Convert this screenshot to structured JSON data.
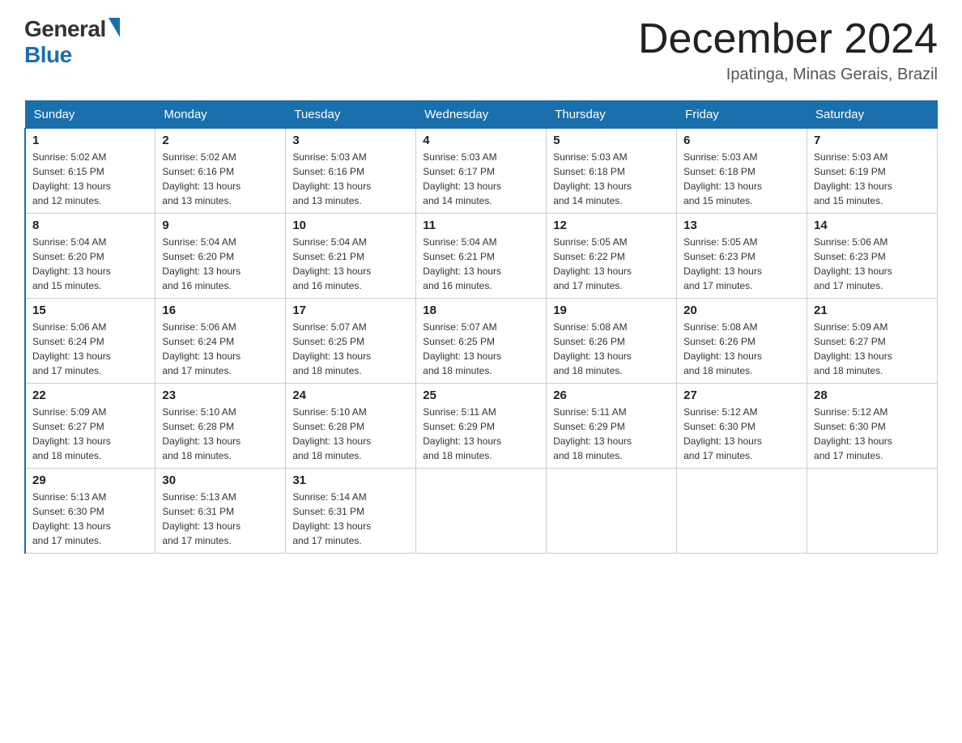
{
  "logo": {
    "general": "General",
    "blue": "Blue"
  },
  "header": {
    "month_year": "December 2024",
    "location": "Ipatinga, Minas Gerais, Brazil"
  },
  "weekdays": [
    "Sunday",
    "Monday",
    "Tuesday",
    "Wednesday",
    "Thursday",
    "Friday",
    "Saturday"
  ],
  "weeks": [
    [
      {
        "day": "1",
        "sunrise": "5:02 AM",
        "sunset": "6:15 PM",
        "daylight": "13 hours and 12 minutes."
      },
      {
        "day": "2",
        "sunrise": "5:02 AM",
        "sunset": "6:16 PM",
        "daylight": "13 hours and 13 minutes."
      },
      {
        "day": "3",
        "sunrise": "5:03 AM",
        "sunset": "6:16 PM",
        "daylight": "13 hours and 13 minutes."
      },
      {
        "day": "4",
        "sunrise": "5:03 AM",
        "sunset": "6:17 PM",
        "daylight": "13 hours and 14 minutes."
      },
      {
        "day": "5",
        "sunrise": "5:03 AM",
        "sunset": "6:18 PM",
        "daylight": "13 hours and 14 minutes."
      },
      {
        "day": "6",
        "sunrise": "5:03 AM",
        "sunset": "6:18 PM",
        "daylight": "13 hours and 15 minutes."
      },
      {
        "day": "7",
        "sunrise": "5:03 AM",
        "sunset": "6:19 PM",
        "daylight": "13 hours and 15 minutes."
      }
    ],
    [
      {
        "day": "8",
        "sunrise": "5:04 AM",
        "sunset": "6:20 PM",
        "daylight": "13 hours and 15 minutes."
      },
      {
        "day": "9",
        "sunrise": "5:04 AM",
        "sunset": "6:20 PM",
        "daylight": "13 hours and 16 minutes."
      },
      {
        "day": "10",
        "sunrise": "5:04 AM",
        "sunset": "6:21 PM",
        "daylight": "13 hours and 16 minutes."
      },
      {
        "day": "11",
        "sunrise": "5:04 AM",
        "sunset": "6:21 PM",
        "daylight": "13 hours and 16 minutes."
      },
      {
        "day": "12",
        "sunrise": "5:05 AM",
        "sunset": "6:22 PM",
        "daylight": "13 hours and 17 minutes."
      },
      {
        "day": "13",
        "sunrise": "5:05 AM",
        "sunset": "6:23 PM",
        "daylight": "13 hours and 17 minutes."
      },
      {
        "day": "14",
        "sunrise": "5:06 AM",
        "sunset": "6:23 PM",
        "daylight": "13 hours and 17 minutes."
      }
    ],
    [
      {
        "day": "15",
        "sunrise": "5:06 AM",
        "sunset": "6:24 PM",
        "daylight": "13 hours and 17 minutes."
      },
      {
        "day": "16",
        "sunrise": "5:06 AM",
        "sunset": "6:24 PM",
        "daylight": "13 hours and 17 minutes."
      },
      {
        "day": "17",
        "sunrise": "5:07 AM",
        "sunset": "6:25 PM",
        "daylight": "13 hours and 18 minutes."
      },
      {
        "day": "18",
        "sunrise": "5:07 AM",
        "sunset": "6:25 PM",
        "daylight": "13 hours and 18 minutes."
      },
      {
        "day": "19",
        "sunrise": "5:08 AM",
        "sunset": "6:26 PM",
        "daylight": "13 hours and 18 minutes."
      },
      {
        "day": "20",
        "sunrise": "5:08 AM",
        "sunset": "6:26 PM",
        "daylight": "13 hours and 18 minutes."
      },
      {
        "day": "21",
        "sunrise": "5:09 AM",
        "sunset": "6:27 PM",
        "daylight": "13 hours and 18 minutes."
      }
    ],
    [
      {
        "day": "22",
        "sunrise": "5:09 AM",
        "sunset": "6:27 PM",
        "daylight": "13 hours and 18 minutes."
      },
      {
        "day": "23",
        "sunrise": "5:10 AM",
        "sunset": "6:28 PM",
        "daylight": "13 hours and 18 minutes."
      },
      {
        "day": "24",
        "sunrise": "5:10 AM",
        "sunset": "6:28 PM",
        "daylight": "13 hours and 18 minutes."
      },
      {
        "day": "25",
        "sunrise": "5:11 AM",
        "sunset": "6:29 PM",
        "daylight": "13 hours and 18 minutes."
      },
      {
        "day": "26",
        "sunrise": "5:11 AM",
        "sunset": "6:29 PM",
        "daylight": "13 hours and 18 minutes."
      },
      {
        "day": "27",
        "sunrise": "5:12 AM",
        "sunset": "6:30 PM",
        "daylight": "13 hours and 17 minutes."
      },
      {
        "day": "28",
        "sunrise": "5:12 AM",
        "sunset": "6:30 PM",
        "daylight": "13 hours and 17 minutes."
      }
    ],
    [
      {
        "day": "29",
        "sunrise": "5:13 AM",
        "sunset": "6:30 PM",
        "daylight": "13 hours and 17 minutes."
      },
      {
        "day": "30",
        "sunrise": "5:13 AM",
        "sunset": "6:31 PM",
        "daylight": "13 hours and 17 minutes."
      },
      {
        "day": "31",
        "sunrise": "5:14 AM",
        "sunset": "6:31 PM",
        "daylight": "13 hours and 17 minutes."
      },
      null,
      null,
      null,
      null
    ]
  ],
  "labels": {
    "sunrise": "Sunrise:",
    "sunset": "Sunset:",
    "daylight": "Daylight:"
  }
}
